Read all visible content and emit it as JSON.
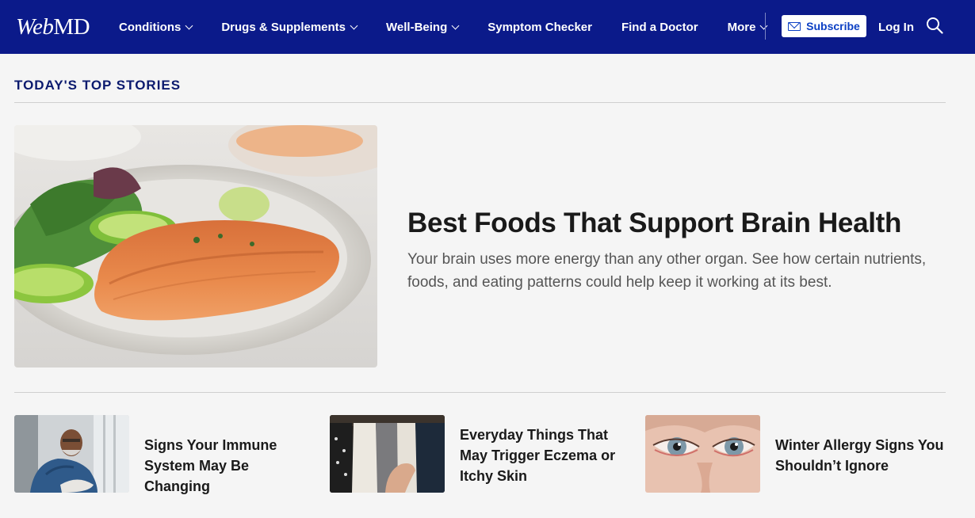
{
  "header": {
    "logo_web": "Web",
    "logo_md": "MD",
    "nav": [
      {
        "label": "Conditions",
        "dropdown": true
      },
      {
        "label": "Drugs & Supplements",
        "dropdown": true
      },
      {
        "label": "Well-Being",
        "dropdown": true
      },
      {
        "label": "Symptom Checker",
        "dropdown": false
      },
      {
        "label": "Find a Doctor",
        "dropdown": false
      },
      {
        "label": "More",
        "dropdown": true
      }
    ],
    "subscribe_label": "Subscribe",
    "login_label": "Log In",
    "icons": [
      "mail-icon",
      "search-icon",
      "chevron-down-icon"
    ]
  },
  "section": {
    "title": "TODAY'S TOP STORIES"
  },
  "hero": {
    "title": "Best Foods That Support Brain Health",
    "description": "Your brain uses more energy than any other organ. See how certain nutrients, foods, and eating patterns could help keep it working at its best."
  },
  "cards": [
    {
      "title": "Signs Your Immune System May Be Changing"
    },
    {
      "title": "Everyday Things That May Trigger Eczema or Itchy Skin"
    },
    {
      "title": "Winter Allergy Signs You Shouldn’t Ignore"
    }
  ],
  "colors": {
    "header_bg": "#0b1a8a",
    "section_title": "#0b1a6e",
    "page_bg": "#f5f5f5"
  }
}
